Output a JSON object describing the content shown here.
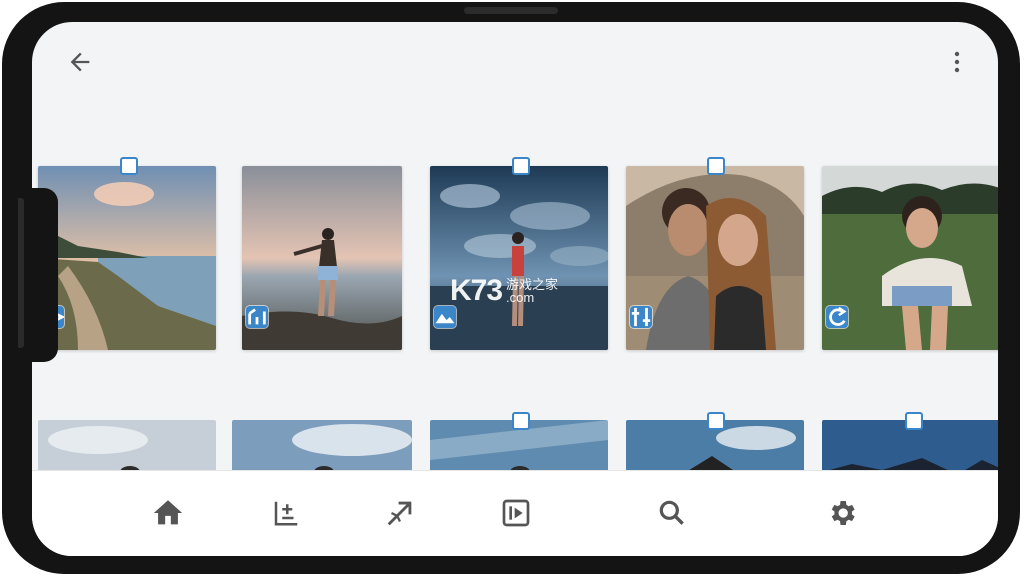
{
  "window": {
    "accent_color": "#3b86c8",
    "frame_color": "#141414"
  },
  "topbar": {
    "back_icon": "arrow-left-icon",
    "menu_icon": "more-vertical-icon"
  },
  "watermark": {
    "logo": "K73",
    "line1": "游戏之家",
    "line2": ".com"
  },
  "gallery": {
    "row1": [
      {
        "name": "photo-coastal-road",
        "badge_icon": "filter-badge-icon",
        "selected": true
      },
      {
        "name": "photo-sunset-woman",
        "badge_icon": "adjust-badge-icon",
        "selected": false
      },
      {
        "name": "photo-cloudy-sea-woman",
        "badge_icon": "landscape-badge-icon",
        "selected": true
      },
      {
        "name": "photo-couple",
        "badge_icon": "tune-badge-icon",
        "selected": true
      },
      {
        "name": "photo-woman-field",
        "badge_icon": "rotate-badge-icon",
        "selected": false
      }
    ],
    "row2": [
      {
        "name": "photo-row2-1",
        "selected": false
      },
      {
        "name": "photo-row2-2",
        "selected": false
      },
      {
        "name": "photo-row2-3",
        "selected": true
      },
      {
        "name": "photo-row2-4",
        "selected": true
      },
      {
        "name": "photo-row2-5",
        "selected": true
      }
    ]
  },
  "bottom_nav": [
    {
      "icon": "home-icon"
    },
    {
      "icon": "add-list-icon"
    },
    {
      "icon": "trending-arrow-icon"
    },
    {
      "icon": "slideshow-icon"
    },
    {
      "icon": "search-icon"
    },
    {
      "icon": "settings-gear-icon"
    }
  ]
}
